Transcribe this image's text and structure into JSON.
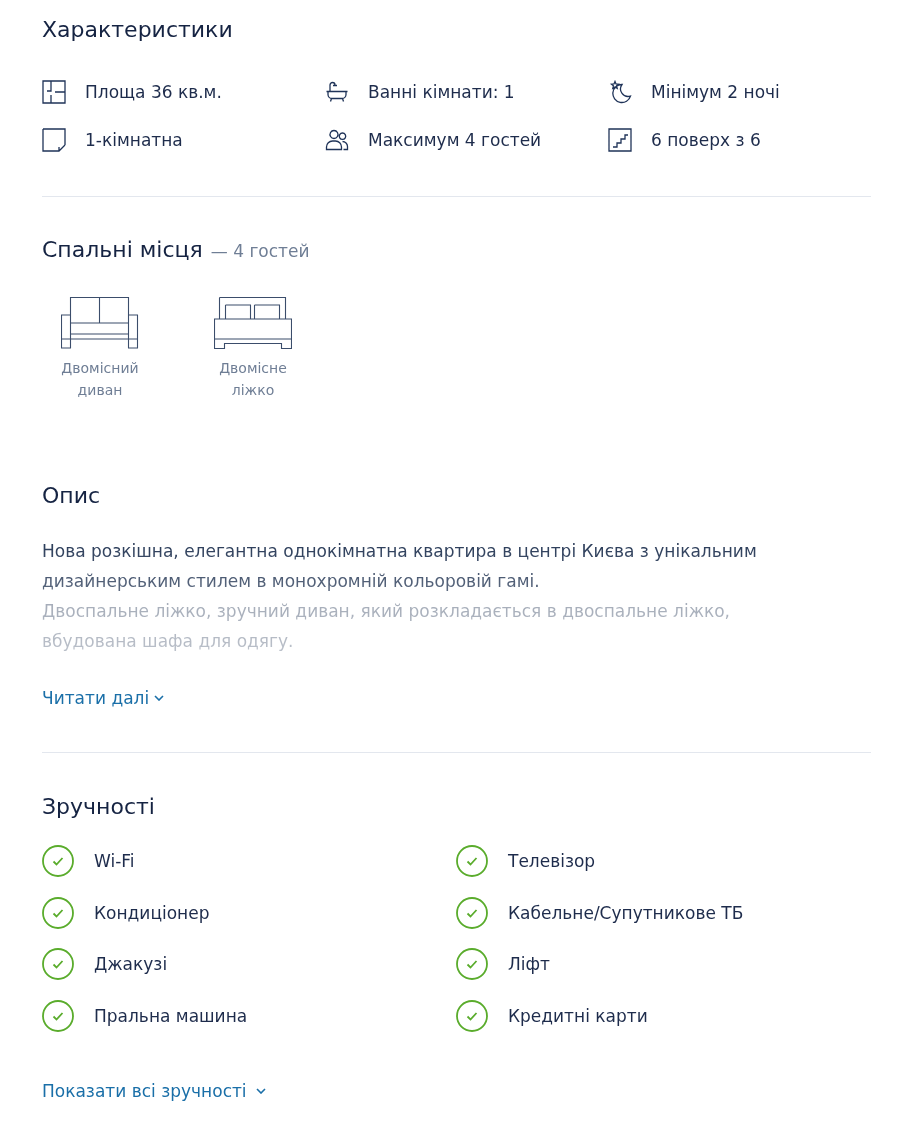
{
  "features": {
    "title": "Характеристики",
    "items": [
      {
        "kind": "area",
        "label": "Площа 36 кв.м."
      },
      {
        "kind": "bathrooms",
        "label": "Ванні кімнати: 1"
      },
      {
        "kind": "nights",
        "label": "Мінімум 2 ночі"
      },
      {
        "kind": "rooms",
        "label": "1-кімнатна"
      },
      {
        "kind": "guests",
        "label": "Максимум 4 гостей"
      },
      {
        "kind": "floor",
        "label": "6 поверх з 6"
      }
    ]
  },
  "sleeping": {
    "title": "Спальні місця",
    "subtitle": "— 4 гостей",
    "beds": [
      {
        "kind": "sofa",
        "label": "Двомісний диван"
      },
      {
        "kind": "bed",
        "label": "Двомісне ліжко"
      }
    ]
  },
  "description": {
    "title": "Опис",
    "paragraphs": [
      "Нова розкішна, елегантна однокімнатна квартира в центрі Києва з унікальним дизайнерським стилем в монохромній кольоровій гамі.",
      "Двоспальне ліжко, зручний диван, який розкладається в двоспальне ліжко, вбудована шафа для одягу."
    ],
    "collapsed": true,
    "more_link": "Читати далі"
  },
  "amenities": {
    "title": "Зручності",
    "items": [
      "Wi-Fi",
      "Телевізор",
      "Кондиціонер",
      "Кабельне/Супутникове ТБ",
      "Джакузі",
      "Ліфт",
      "Пральна машина",
      "Кредитні карти"
    ],
    "more_link": "Показати всі зручності"
  }
}
